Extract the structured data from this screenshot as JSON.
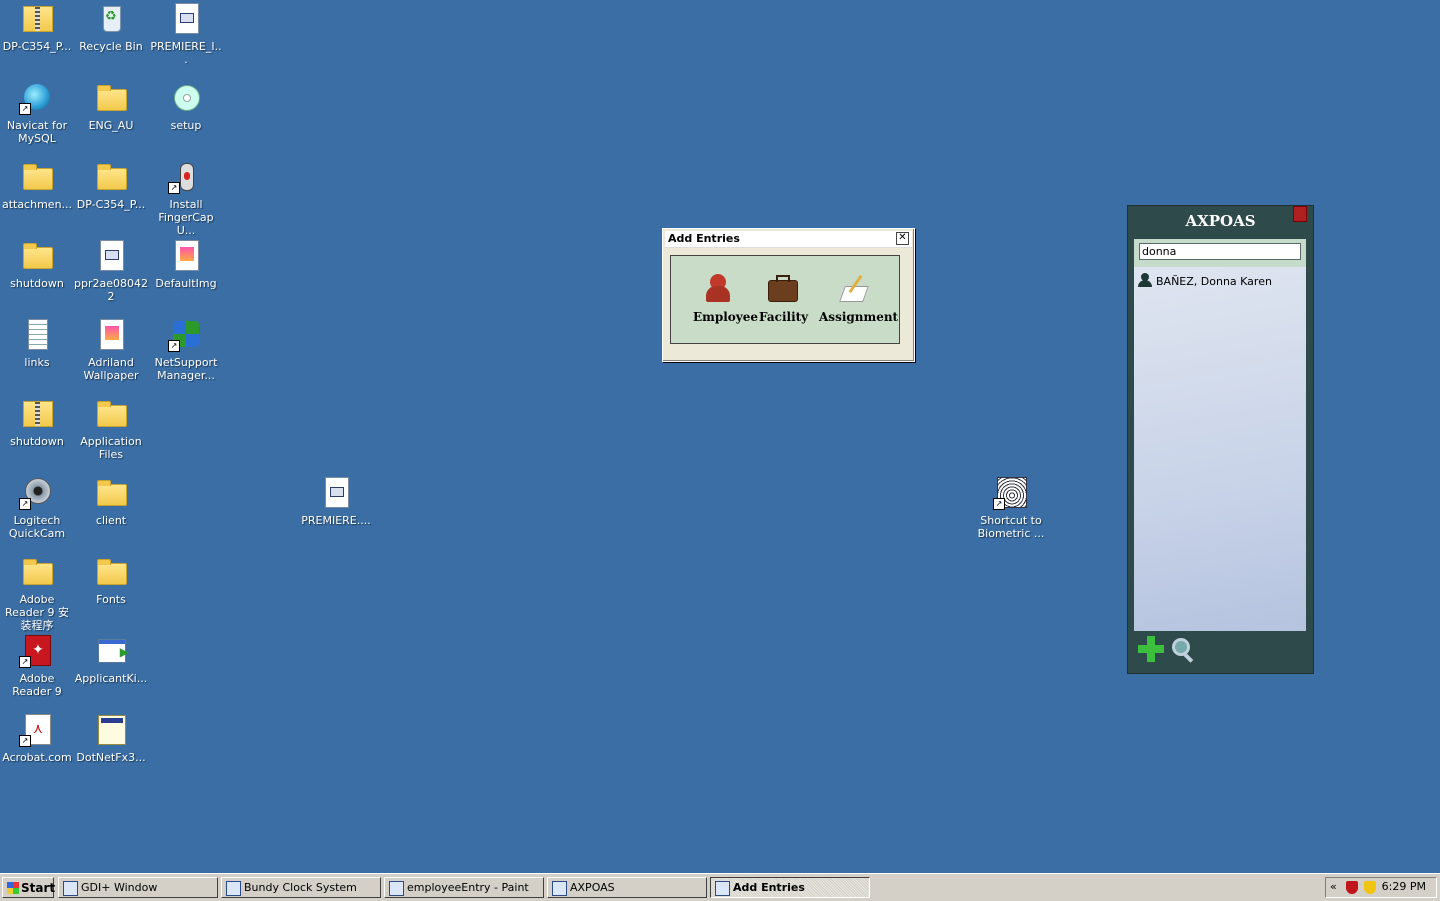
{
  "desktop": {
    "icons": [
      {
        "label": "DP-C354_P...",
        "icon": "zip-folder-icon"
      },
      {
        "label": "Recycle Bin",
        "icon": "recycle-bin-icon"
      },
      {
        "label": "PREMIERE_I...",
        "icon": "application-doc-icon"
      },
      {
        "label": "Navicat for MySQL",
        "icon": "navicat-icon"
      },
      {
        "label": "ENG_AU",
        "icon": "folder-icon"
      },
      {
        "label": "setup",
        "icon": "setup-disc-icon"
      },
      {
        "label": "attachmen...",
        "icon": "folder-icon"
      },
      {
        "label": "DP-C354_P...",
        "icon": "folder-icon"
      },
      {
        "label": "Install FingerCap U...",
        "icon": "mouse-installer-icon"
      },
      {
        "label": "shutdown",
        "icon": "folder-icon"
      },
      {
        "label": "ppr2ae080422",
        "icon": "document-icon"
      },
      {
        "label": "DefaultImg",
        "icon": "image-file-icon"
      },
      {
        "label": "links",
        "icon": "text-file-icon"
      },
      {
        "label": "Adriland Wallpaper",
        "icon": "image-file-icon"
      },
      {
        "label": "NetSupport Manager...",
        "icon": "netsupport-icon"
      },
      {
        "label": "shutdown",
        "icon": "zip-folder-icon"
      },
      {
        "label": "Application Files",
        "icon": "folder-icon"
      },
      {
        "label": "Logitech QuickCam",
        "icon": "webcam-icon"
      },
      {
        "label": "client",
        "icon": "folder-icon"
      },
      {
        "label": "Adobe Reader 9 安装程序",
        "icon": "folder-icon"
      },
      {
        "label": "Fonts",
        "icon": "folder-icon"
      },
      {
        "label": "Adobe Reader 9",
        "icon": "adobe-reader-icon"
      },
      {
        "label": "ApplicantKi...",
        "icon": "application-icon"
      },
      {
        "label": "Acrobat.com",
        "icon": "acrobat-icon"
      },
      {
        "label": "DotNetFx3...",
        "icon": "setup-icon"
      },
      {
        "label": "PREMIERE....",
        "icon": "application-doc-icon"
      },
      {
        "label": "Shortcut to Biometric ...",
        "icon": "fingerprint-icon"
      }
    ]
  },
  "add_entries_dialog": {
    "title": "Add Entries",
    "close_symbol": "✕",
    "items": [
      {
        "label": "Employee",
        "icon": "employee-icon"
      },
      {
        "label": "Facility",
        "icon": "facility-briefcase-icon"
      },
      {
        "label": "Assignment",
        "icon": "assignment-icon"
      }
    ]
  },
  "axpoas_widget": {
    "title": "AXPOAS",
    "search_value": "donna",
    "results": [
      {
        "name": "BAÑEZ, Donna Karen",
        "icon": "person-icon"
      }
    ]
  },
  "taskbar": {
    "start_label": "Start",
    "tasks": [
      {
        "label": "GDI+ Window",
        "active": false
      },
      {
        "label": "Bundy Clock System",
        "active": false
      },
      {
        "label": "employeeEntry - Paint",
        "active": false
      },
      {
        "label": "AXPOAS",
        "active": false
      },
      {
        "label": "Add Entries",
        "active": true
      }
    ],
    "tray_chevron": "«",
    "clock": "6:29 PM"
  }
}
